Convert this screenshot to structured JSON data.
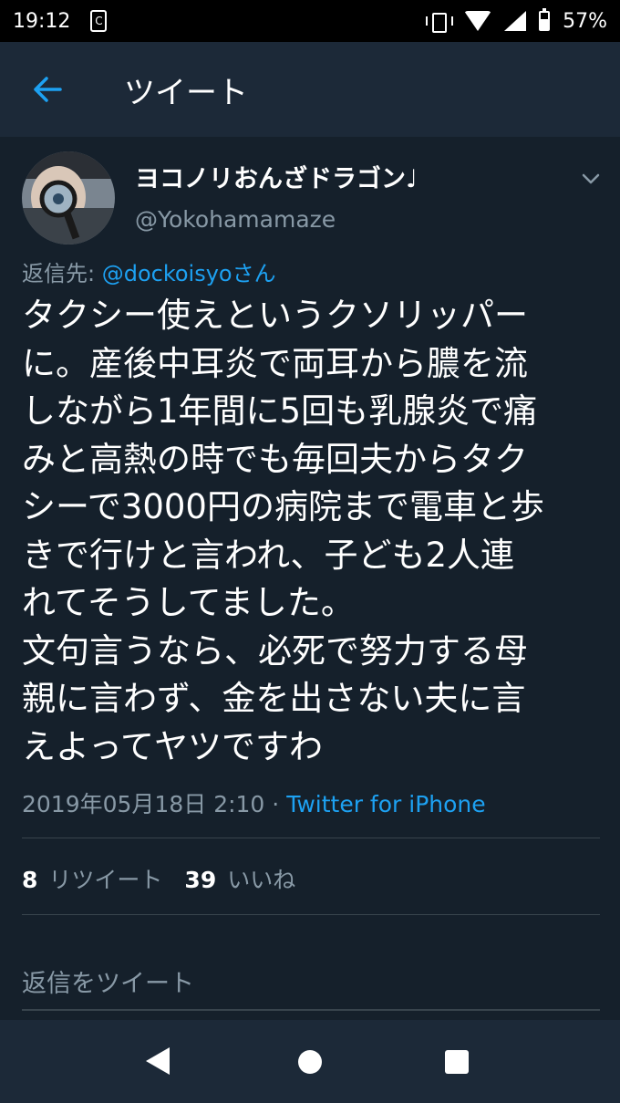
{
  "status_bar": {
    "time": "19:12",
    "battery_percent": "57%",
    "icons": [
      "app-notification-icon",
      "vibrate-icon",
      "wifi-icon",
      "signal-icon",
      "battery-icon"
    ]
  },
  "app_bar": {
    "title": "ツイート",
    "back_icon": "arrow-left-icon",
    "accent_color": "#1da1f2"
  },
  "tweet": {
    "display_name": "ヨコノリおんざドラゴン♩",
    "handle": "@Yokohamamaze",
    "reply_prefix": "返信先: ",
    "reply_mention": "@dockoisyoさん",
    "body_lines": [
      "タクシー使えというクソリッパー",
      "に。産後中耳炎で両耳から膿を流",
      "しながら1年間に5回も乳腺炎で痛",
      "みと高熱の時でも毎回夫からタク",
      "シーで3000円の病院まで電車と歩",
      "きで行けと言われ、子ども2人連",
      "れてそうしてました。",
      "文句言うなら、必死で努力する母",
      "親に言わず、金を出さない夫に言",
      "えよってヤツですわ"
    ],
    "timestamp": "2019年05月18日 2:10",
    "separator": " · ",
    "source": "Twitter for iPhone",
    "retweet_count": "8",
    "retweet_label": "リツイート",
    "like_count": "39",
    "like_label": "いいね"
  },
  "reply": {
    "placeholder": "返信をツイート"
  },
  "nav_bar": {
    "buttons": [
      "back-triangle-icon",
      "home-circle-icon",
      "recents-square-icon"
    ]
  }
}
